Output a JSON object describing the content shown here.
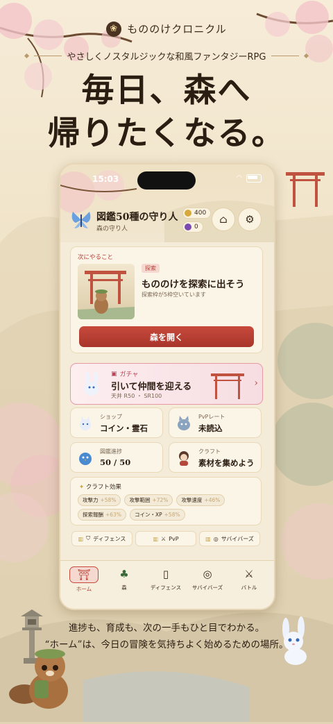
{
  "header": {
    "brand": "もののけクロニクル",
    "brand_emblem": "❀",
    "tagline": "やさしくノスタルジックな和風ファンタジーRPG",
    "headline_line1": "毎日、森へ",
    "headline_line2": "帰りたくなる。"
  },
  "status_bar": {
    "time": "15:03"
  },
  "profile": {
    "title": "図鑑50種の守り人",
    "subtitle": "森の守り人",
    "coins": "400",
    "orbs": "0"
  },
  "next_action": {
    "label": "次にやること",
    "tag": "探索",
    "title": "もののけを探索に出そう",
    "subtitle": "探索枠が5枠空いています",
    "button": "森を開く"
  },
  "gacha": {
    "tag": "ガチャ",
    "title": "引いて仲間を迎える",
    "subtitle": "天井 R50 ・ SR100",
    "arrow": "›"
  },
  "tiles": [
    {
      "label": "ショップ",
      "value": "コイン・霊石"
    },
    {
      "label": "PvPレート",
      "value": "未読込"
    },
    {
      "label": "図鑑進捗",
      "value": "50 / 50"
    },
    {
      "label": "クラフト",
      "value": "素材を集めよう"
    }
  ],
  "craft_effects": {
    "title": "クラフト効果",
    "items": [
      {
        "name": "攻撃力",
        "value": "+58%"
      },
      {
        "name": "攻撃範囲",
        "value": "+72%"
      },
      {
        "name": "攻撃速度",
        "value": "+46%"
      },
      {
        "name": "探索報酬",
        "value": "+63%"
      },
      {
        "name": "コイン・XP",
        "value": "+58%"
      }
    ]
  },
  "mode_buttons": [
    "ディフェンス",
    "PvP",
    "サバイバーズ"
  ],
  "tabbar": [
    {
      "label": "ホーム",
      "icon": "torii-icon"
    },
    {
      "label": "森",
      "icon": "tree-icon"
    },
    {
      "label": "ディフェンス",
      "icon": "tower-icon"
    },
    {
      "label": "サバイバーズ",
      "icon": "compass-icon"
    },
    {
      "label": "バトル",
      "icon": "swords-icon"
    }
  ],
  "footer": {
    "line1": "進捗も、育成も、次の一手もひと目でわかる。",
    "line2": "“ホーム”は、今日の冒険を気持ちよく始めるための場所。"
  },
  "colors": {
    "accent_red": "#b33a2e",
    "paper": "#f4ebd8",
    "ink": "#2c1e12",
    "sakura": "#f2c4c8"
  }
}
